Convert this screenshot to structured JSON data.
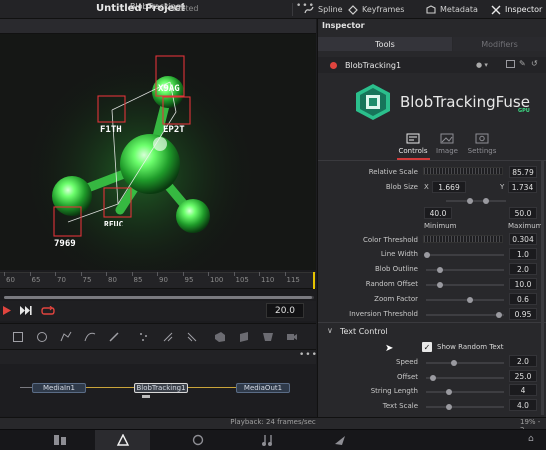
{
  "topbar": {
    "title": "Untitled Project",
    "edited": "Edited",
    "buttons": [
      {
        "label": "Spline",
        "icon": "spline-icon"
      },
      {
        "label": "Keyframes",
        "icon": "keyframes-icon"
      },
      {
        "label": "Metadata",
        "icon": "metadata-icon"
      },
      {
        "label": "Inspector",
        "icon": "inspector-icon"
      }
    ]
  },
  "viewer": {
    "title": "BlobTracking1",
    "menu": "•••",
    "blob_labels": [
      "X9AG",
      "F1TH",
      "EP2T",
      "7969",
      "RFUC"
    ]
  },
  "timeline": {
    "ticks": [
      "60",
      "65",
      "70",
      "75",
      "80",
      "85",
      "90",
      "95",
      "100",
      "105",
      "110",
      "115"
    ],
    "frame": "20.0",
    "playhead_fraction": 0.99
  },
  "transport": {
    "play_icon": "play-icon",
    "next_icon": "skip-end-icon",
    "loop_icon": "loop-icon"
  },
  "nodes": {
    "menu": "•••",
    "media_in": "MediaIn1",
    "blob": "BlobTracking1",
    "media_out": "MediaOut1"
  },
  "status": {
    "playback": "Playback: 24 frames/sec",
    "right": "19% - 2"
  },
  "pages": [
    "media-page-icon",
    "fusion-page-icon",
    "color-page-icon",
    "fairlight-page-icon",
    "deliver-page-icon"
  ],
  "inspector": {
    "title": "Inspector",
    "tabs": {
      "tools": "Tools",
      "modifiers": "Modifiers"
    },
    "node_name": "BlobTracking1",
    "plugin_name": "BlobTrackingFuse",
    "plugin_sub": "GPU",
    "sub_tabs": [
      "Controls",
      "Image",
      "Settings"
    ],
    "params": {
      "relative_scale": {
        "label": "Relative Scale",
        "value": "85.79"
      },
      "blob_size": {
        "label": "Blob Size",
        "x_label": "X",
        "x": "1.669",
        "y_label": "Y",
        "y": "1.734"
      },
      "range": {
        "min": "40.0",
        "max": "50.0",
        "min_label": "Minimum",
        "max_label": "Maximum"
      },
      "color_threshold": {
        "label": "Color Threshold",
        "value": "0.304"
      },
      "line_width": {
        "label": "Line Width",
        "value": "1.0"
      },
      "blob_outline": {
        "label": "Blob Outline",
        "value": "2.0"
      },
      "random_offset": {
        "label": "Random Offset",
        "value": "10.0"
      },
      "zoom_factor": {
        "label": "Zoom Factor",
        "value": "0.6"
      },
      "inversion_threshold": {
        "label": "Inversion Threshold",
        "value": "0.95"
      }
    },
    "text_control": {
      "header": "Text Control",
      "show_random_text": "Show Random Text",
      "checked": true,
      "speed": {
        "label": "Speed",
        "value": "2.0"
      },
      "offset": {
        "label": "Offset",
        "value": "25.0"
      },
      "string_length": {
        "label": "String Length",
        "value": "4"
      },
      "text_scale": {
        "label": "Text Scale",
        "value": "4.0"
      }
    }
  },
  "colors": {
    "accent": "#e0443e",
    "green": "#3ddc84",
    "node_link": "#c9a43a"
  }
}
